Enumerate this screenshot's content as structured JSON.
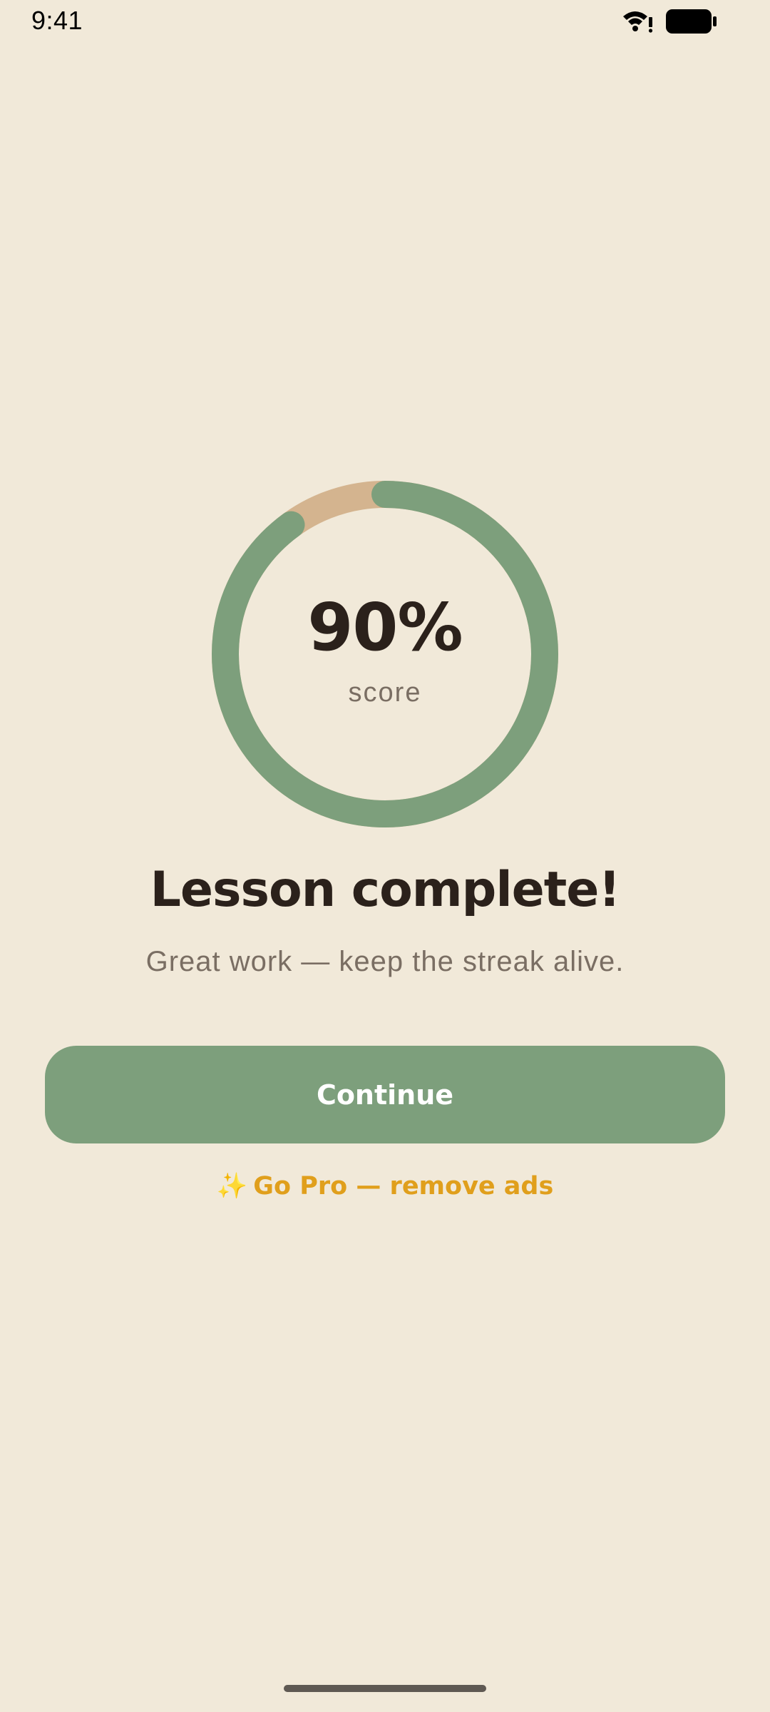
{
  "status_bar": {
    "time": "9:41",
    "icons": [
      "wifi-icon",
      "battery-icon"
    ]
  },
  "result": {
    "score_value": "90%",
    "score_caption": "score",
    "progress_fraction": 0.9,
    "colors": {
      "progress": "#7D9F7C",
      "track": "#D4B48F"
    }
  },
  "message": {
    "title": "Lesson complete!",
    "subtitle": "Great work — keep the streak alive."
  },
  "actions": {
    "continue_label": "Continue",
    "pro_icon": "sparkles-icon",
    "pro_icon_glyph": "✨",
    "pro_label": "Go Pro — remove ads"
  },
  "theme": {
    "background": "#F1E9D9",
    "accent_green": "#7D9F7C",
    "accent_gold": "#E09F1C",
    "text_dark": "#2B211B",
    "text_muted": "#7A6E63"
  }
}
